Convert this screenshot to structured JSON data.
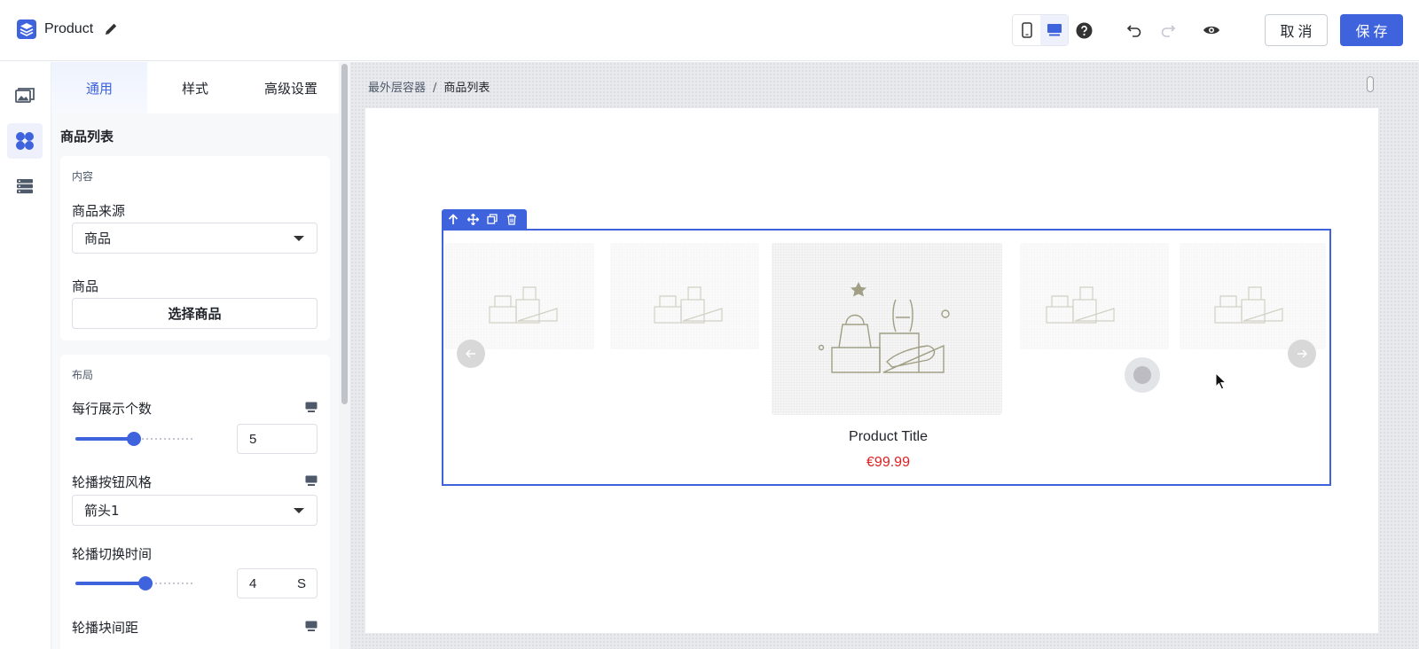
{
  "header": {
    "title": "Product",
    "cancel_label": "取消",
    "save_label": "保存"
  },
  "panel": {
    "tabs": [
      {
        "label": "通用",
        "active": true
      },
      {
        "label": "样式",
        "active": false
      },
      {
        "label": "高级设置",
        "active": false
      }
    ],
    "title": "商品列表",
    "content_card": {
      "heading": "内容",
      "source_label": "商品来源",
      "source_value": "商品",
      "product_label": "商品",
      "select_button": "选择商品"
    },
    "layout_card": {
      "heading": "布局",
      "per_row_label": "每行展示个数",
      "per_row_value": "5",
      "per_row_fraction": 0.5,
      "button_style_label": "轮播按钮风格",
      "button_style_value": "箭头1",
      "interval_label": "轮播切换时间",
      "interval_value": "4",
      "interval_unit": "S",
      "interval_fraction": 0.6,
      "spacing_label": "轮播块间距"
    }
  },
  "canvas": {
    "breadcrumb": {
      "root": "最外层容器",
      "separator": "/",
      "current": "商品列表"
    },
    "product": {
      "title": "Product Title",
      "price": "€99.99"
    }
  },
  "colors": {
    "accent": "#3e63dd",
    "price": "#e02020"
  }
}
